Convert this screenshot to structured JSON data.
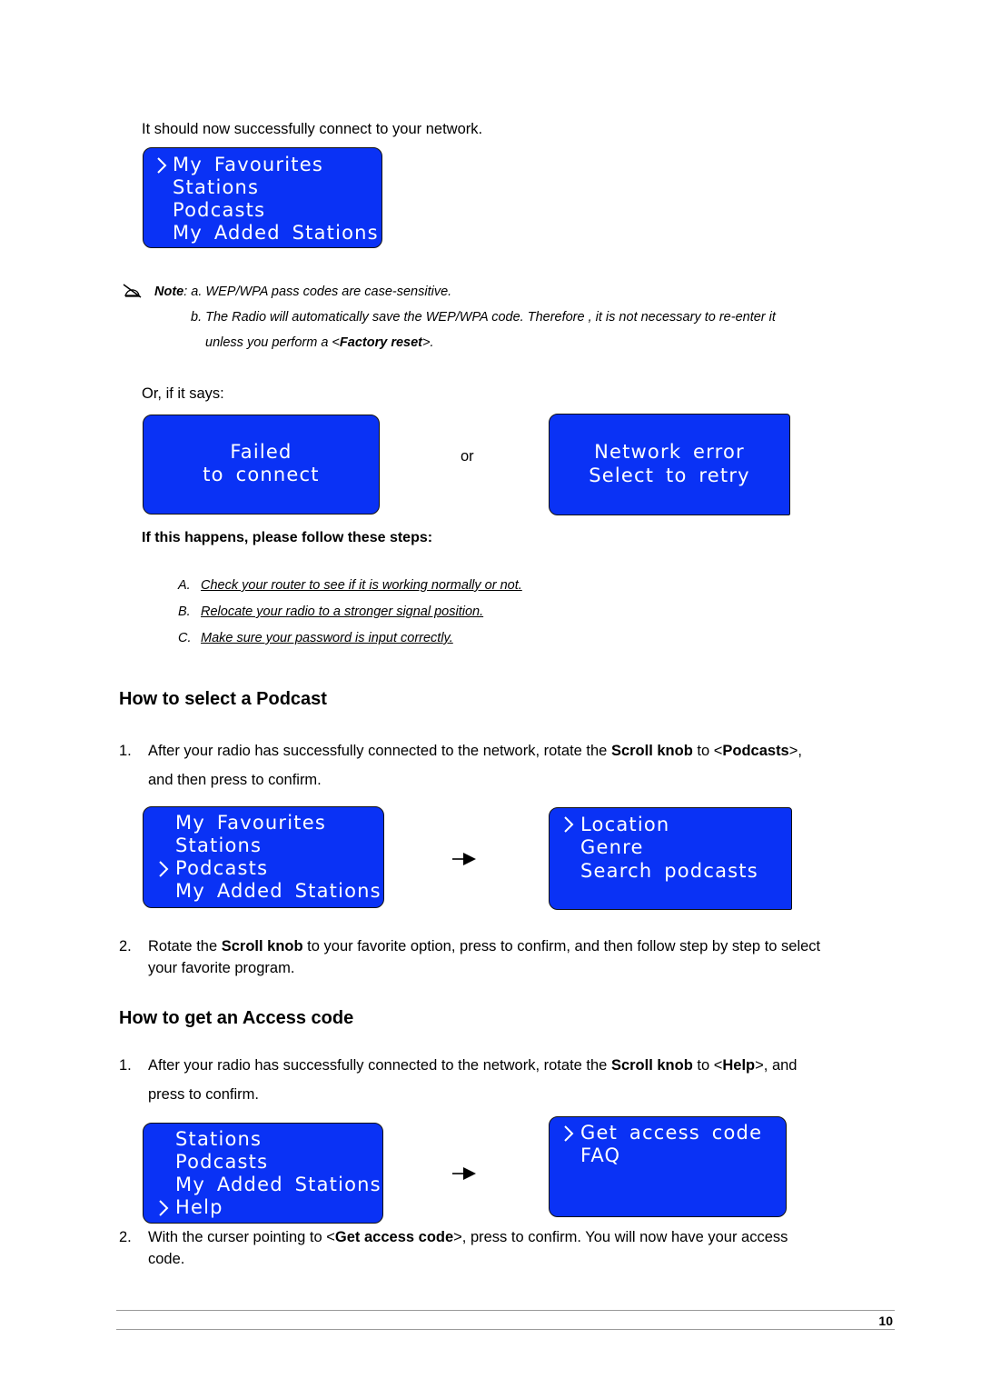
{
  "intro_text": "It should now successfully connect to your network.",
  "menu_main_1": {
    "lines": [
      "My  Favourites",
      "Stations",
      "Podcasts",
      "My  Added  Stations"
    ],
    "selected_index": 0
  },
  "note": {
    "icon": "writing-hand-icon",
    "label": "Note",
    "line_a": ": a. WEP/WPA pass codes are case-sensitive.",
    "line_b": "b. The Radio will automatically save the WEP/WPA code. Therefore , it is not necessary to re-enter it",
    "line_c_pre": "unless you perform a <",
    "line_c_bold": "Factory reset",
    "line_c_post": ">."
  },
  "or_if_it_says": "Or, if it says:",
  "error_display_1": {
    "lines": [
      "Failed",
      "to  connect"
    ]
  },
  "or_text": "or",
  "error_display_2": {
    "lines": [
      "Network  error",
      "Select  to  retry"
    ]
  },
  "steps_heading": "If this happens, please follow these steps:",
  "steps": [
    {
      "label": "A.",
      "text": "Check your router to see if it is working normally or not."
    },
    {
      "label": "B.",
      "text": "Relocate your radio to a stronger signal position."
    },
    {
      "label": "C.",
      "text": "Make sure your password is input correctly."
    }
  ],
  "section_podcast": {
    "title": "How to select a Podcast",
    "step1": {
      "num": "1.",
      "pre": "After your radio has successfully connected to the network, rotate the ",
      "bold1": "Scroll knob",
      "mid": " to <",
      "bold2": "Podcasts",
      "post": ">,",
      "line2": "and then press to confirm."
    },
    "menu_left": {
      "lines": [
        "My  Favourites",
        "Stations",
        "Podcasts",
        "My  Added  Stations"
      ],
      "selected_index": 2
    },
    "menu_right": {
      "lines": [
        "Location",
        "Genre",
        "Search  podcasts"
      ],
      "selected_index": 0
    },
    "step2": {
      "num": "2.",
      "pre": "Rotate the ",
      "bold1": "Scroll knob",
      "post": " to your favorite option, press to confirm, and then follow step by step to select",
      "line2": "your favorite program."
    }
  },
  "section_access": {
    "title": "How to get an Access code",
    "step1": {
      "num": "1.",
      "pre": "After your radio has successfully connected to the network, rotate the ",
      "bold1": "Scroll knob",
      "mid": " to <",
      "bold2": "Help",
      "post": ">, and",
      "line2": "press to confirm."
    },
    "menu_left": {
      "lines": [
        "Stations",
        "Podcasts",
        "My  Added  Stations",
        "Help"
      ],
      "selected_index": 3
    },
    "menu_right": {
      "lines": [
        "Get  access  code",
        "FAQ"
      ],
      "selected_index": 0
    },
    "step2": {
      "num": "2.",
      "pre": "With the curser pointing to <",
      "bold1": "Get access code",
      "post": ">, press to confirm. You will now have your access",
      "line2": "code."
    }
  },
  "footer": {
    "page_number": "10"
  },
  "colors": {
    "lcd_blue": "#0a32f5",
    "lcd_text": "#ffffff"
  }
}
